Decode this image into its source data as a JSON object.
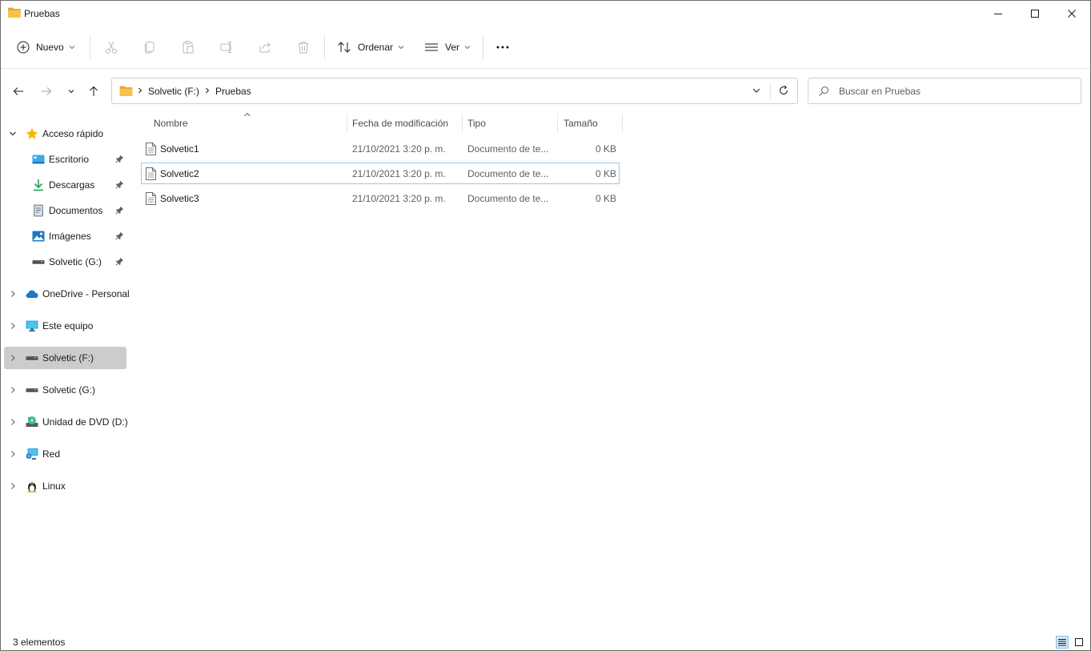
{
  "window": {
    "title": "Pruebas",
    "controls": [
      "minimize-icon",
      "maximize-icon",
      "close-icon"
    ]
  },
  "commandbar": {
    "new_label": "Nuevo",
    "sort_label": "Ordenar",
    "view_label": "Ver",
    "icons": [
      "cut-icon",
      "copy-icon",
      "paste-icon",
      "rename-icon",
      "share-icon",
      "delete-icon",
      "more-icon"
    ]
  },
  "address": {
    "crumbs": [
      "Solvetic (F:)",
      "Pruebas"
    ]
  },
  "search": {
    "placeholder": "Buscar en Pruebas",
    "value": ""
  },
  "sidebar": {
    "quick_access": {
      "label": "Acceso rápido",
      "items": [
        {
          "label": "Escritorio",
          "icon": "desktop-icon"
        },
        {
          "label": "Descargas",
          "icon": "download-icon"
        },
        {
          "label": "Documentos",
          "icon": "documents-icon"
        },
        {
          "label": "Imágenes",
          "icon": "pictures-icon"
        },
        {
          "label": "Solvetic (G:)",
          "icon": "drive-icon"
        }
      ]
    },
    "roots": [
      {
        "label": "OneDrive - Personal",
        "icon": "onedrive-icon"
      },
      {
        "label": "Este equipo",
        "icon": "computer-icon"
      },
      {
        "label": "Solvetic (F:)",
        "icon": "drive-icon",
        "selected": true
      },
      {
        "label": "Solvetic (G:)",
        "icon": "drive-icon"
      },
      {
        "label": "Unidad de DVD (D:)",
        "icon": "dvd-icon"
      },
      {
        "label": "Red",
        "icon": "network-icon"
      },
      {
        "label": "Linux",
        "icon": "linux-icon"
      }
    ]
  },
  "filelist": {
    "columns": [
      "Nombre",
      "Fecha de modificación",
      "Tipo",
      "Tamaño"
    ],
    "rows": [
      {
        "name": "Solvetic1",
        "date": "21/10/2021 3:20 p. m.",
        "type": "Documento de te...",
        "size": "0 KB"
      },
      {
        "name": "Solvetic2",
        "date": "21/10/2021 3:20 p. m.",
        "type": "Documento de te...",
        "size": "0 KB"
      },
      {
        "name": "Solvetic3",
        "date": "21/10/2021 3:20 p. m.",
        "type": "Documento de te...",
        "size": "0 KB"
      }
    ]
  },
  "status": {
    "count": "3 elementos"
  },
  "colors": {
    "folder": "#f8c24a",
    "star": "#f5b800",
    "accent": "#0067c0",
    "selection": "#cccccc",
    "focus_border": "#99c8ea"
  }
}
